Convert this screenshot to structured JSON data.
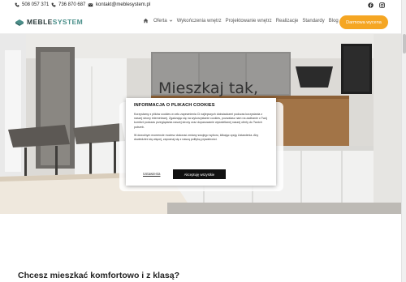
{
  "topbar": {
    "phone1": "508 057 371",
    "phone2": "736 870 687",
    "email": "kontakt@meblesystem.pl",
    "social": [
      "facebook-icon",
      "instagram-icon"
    ]
  },
  "nav": {
    "logo_main": "MEBLE",
    "logo_accent": "SYSTEM",
    "items": [
      {
        "label": "Oferta",
        "has_dropdown": true
      },
      {
        "label": "Wykończenia wnętrz",
        "has_dropdown": false
      },
      {
        "label": "Projektowanie wnętrz",
        "has_dropdown": false
      },
      {
        "label": "Realizacje",
        "has_dropdown": false
      },
      {
        "label": "Standardy",
        "has_dropdown": false
      },
      {
        "label": "Blog",
        "has_dropdown": false
      }
    ],
    "cta_label": "Darmowa wycena"
  },
  "hero": {
    "title": "Mieszkaj tak,"
  },
  "cookie": {
    "title": "INFORMACJA O PLIKACH COOKIES",
    "paragraph1": "Korzystamy z plików cookies w celu zapewnienia Ci najlepszych doświadczeń podczas korzystania z naszej strony internetowej. Zgadzając się na wykorzystanie cookies, pozwalasz nam na zadbanie o Twój komfort podczas przeglądania naszej strony oraz dopasowanie wyświetlanej naszej oferty do Twoich potrzeb.",
    "paragraph2": "W dowolnym momencie możesz dokonać zmiany swojego wyboru, klikając opcję Ustawienia. Aby dowiedzieć się więcej, zapoznaj się z naszą polityką prywatności.",
    "settings_label": "Ustawienia",
    "accept_label": "Akceptuję wszystkie"
  },
  "section": {
    "title": "Chcesz mieszkać komfortowo i z klasą?"
  },
  "colors": {
    "accent_orange": "#f5a623",
    "logo_teal": "#4a8f8a",
    "button_dark": "#111111"
  }
}
